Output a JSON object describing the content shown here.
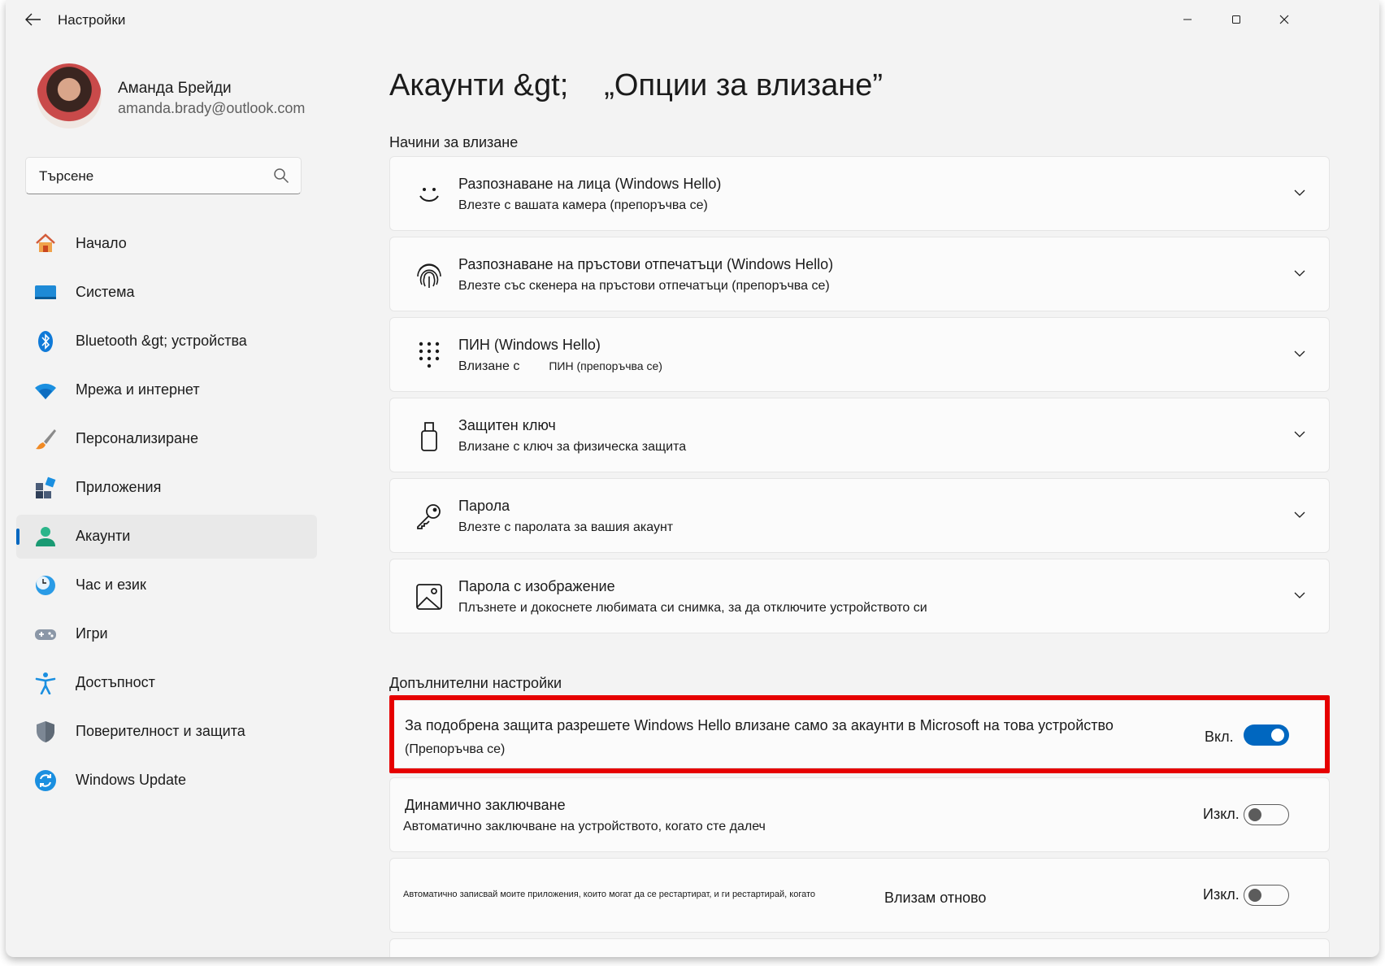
{
  "window": {
    "title": "Настройки"
  },
  "profile": {
    "name": "Аманда Брейди",
    "email": "amanda.brady@outlook.com"
  },
  "search": {
    "placeholder": "Търсене"
  },
  "sidebar": {
    "items": [
      {
        "label": "Начало",
        "icon": "home-icon"
      },
      {
        "label": "Система",
        "icon": "system-icon"
      },
      {
        "label": "Bluetooth &gt; устройства",
        "icon": "bluetooth-icon"
      },
      {
        "label": "Мрежа и интернет",
        "icon": "wifi-icon"
      },
      {
        "label": "Персонализиране",
        "icon": "brush-icon"
      },
      {
        "label": "Приложения",
        "icon": "apps-icon"
      },
      {
        "label": "Акаунти",
        "icon": "accounts-icon",
        "active": true
      },
      {
        "label": "Час и език",
        "icon": "clock-globe-icon"
      },
      {
        "label": "Игри",
        "icon": "gamepad-icon"
      },
      {
        "label": "Достъпност",
        "icon": "accessibility-icon"
      },
      {
        "label": "Поверителност и защита",
        "icon": "shield-icon"
      },
      {
        "label": "Windows Update",
        "icon": "update-icon"
      }
    ]
  },
  "main": {
    "breadcrumb_parent": "Акаунти &gt;",
    "breadcrumb_current": "„Опции за влизане”",
    "signin_section_title": "Начини за влизане",
    "signin_methods": [
      {
        "title": "Разпознаване на лица (Windows Hello)",
        "subtitle": "Влезте с вашата камера (препоръчва се)",
        "icon": "face-icon"
      },
      {
        "title": "Разпознаване на пръстови отпечатъци (Windows Hello)",
        "subtitle": "Влезте със скенера на пръстови отпечатъци (препоръчва се)",
        "icon": "fingerprint-icon"
      },
      {
        "title": "ПИН (Windows Hello)",
        "subtitle_a": "Влизане с",
        "subtitle_b": "ПИН (препоръчва се)",
        "icon": "pin-keypad-icon"
      },
      {
        "title": "Защитен ключ",
        "subtitle": "Влизане с ключ за физическа защита",
        "icon": "security-key-icon"
      },
      {
        "title": "Парола",
        "subtitle": "Влезте с паролата за вашия акаунт",
        "icon": "key-icon"
      },
      {
        "title": "Парола с изображение",
        "subtitle": "Плъзнете и докоснете любимата си снимка, за да отключите устройството си",
        "icon": "picture-icon"
      }
    ],
    "additional_section_title": "Допълнителни настройки",
    "additional_settings": [
      {
        "title": "За подобрена защита разрешете Windows Hello влизане само за акаунти в Microsoft на това устройство",
        "subtitle": "(Препоръчва се)",
        "status": "Вкл.",
        "on": true
      },
      {
        "title": "Динамично заключване",
        "subtitle": "Автоматично заключване на устройството, когато сте далеч",
        "status": "Изкл.",
        "on": false
      },
      {
        "title_small": "Автоматично записвай моите приложения, които могат да се рестартират, и ги рестартирай, когато",
        "title_large": "Влизам отново",
        "status": "Изкл.",
        "on": false
      }
    ]
  },
  "colors": {
    "accent": "#0067c0",
    "highlight": "#e60000"
  }
}
